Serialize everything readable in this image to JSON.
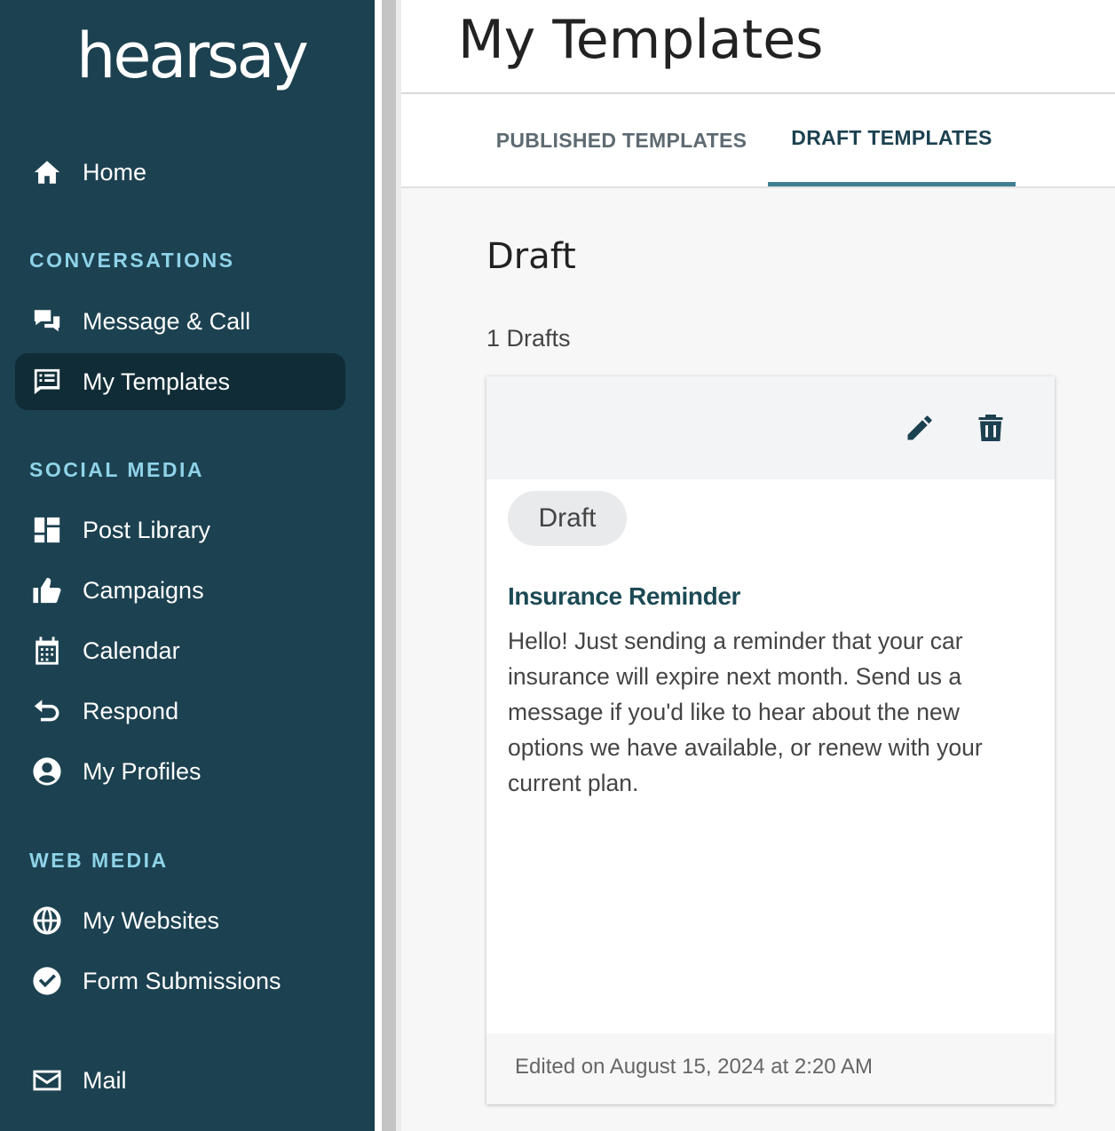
{
  "brand": {
    "logo_text": "hearsay"
  },
  "sidebar": {
    "home": {
      "label": "Home",
      "icon": "home-icon"
    },
    "sections": {
      "conversations": "CONVERSATIONS",
      "social_media": "SOCIAL MEDIA",
      "web_media": "WEB MEDIA"
    },
    "items": {
      "message_call": {
        "label": "Message & Call",
        "icon": "chat-bubbles-icon"
      },
      "my_templates": {
        "label": "My Templates",
        "icon": "template-icon",
        "active": true
      },
      "post_library": {
        "label": "Post Library",
        "icon": "dashboard-icon"
      },
      "campaigns": {
        "label": "Campaigns",
        "icon": "thumbs-up-icon"
      },
      "calendar": {
        "label": "Calendar",
        "icon": "calendar-icon"
      },
      "respond": {
        "label": "Respond",
        "icon": "reply-icon"
      },
      "my_profiles": {
        "label": "My Profiles",
        "icon": "user-circle-icon"
      },
      "my_websites": {
        "label": "My Websites",
        "icon": "globe-icon"
      },
      "form_submissions": {
        "label": "Form Submissions",
        "icon": "check-circle-icon"
      },
      "mail": {
        "label": "Mail",
        "icon": "mail-icon"
      }
    }
  },
  "header": {
    "title": "My Templates"
  },
  "tabs": {
    "published": "PUBLISHED TEMPLATES",
    "draft": "DRAFT TEMPLATES",
    "active": "draft"
  },
  "main": {
    "title": "Draft",
    "count": "1 Drafts",
    "card": {
      "badge": "Draft",
      "name": "Insurance Reminder",
      "body": "Hello! Just sending a reminder that your car insurance will expire next month. Send us a message if you'd like to hear about the new options we have available, or renew with your current plan.",
      "edited": "Edited on August 15, 2024 at 2:20 AM",
      "actions": [
        "pencil-icon",
        "trash-icon"
      ]
    }
  },
  "colors": {
    "sidebar_bg": "#1c4150",
    "active_item_bg": "#102c36",
    "section_label": "#8fd3e8",
    "tab_indicator": "#3f7f8f"
  }
}
